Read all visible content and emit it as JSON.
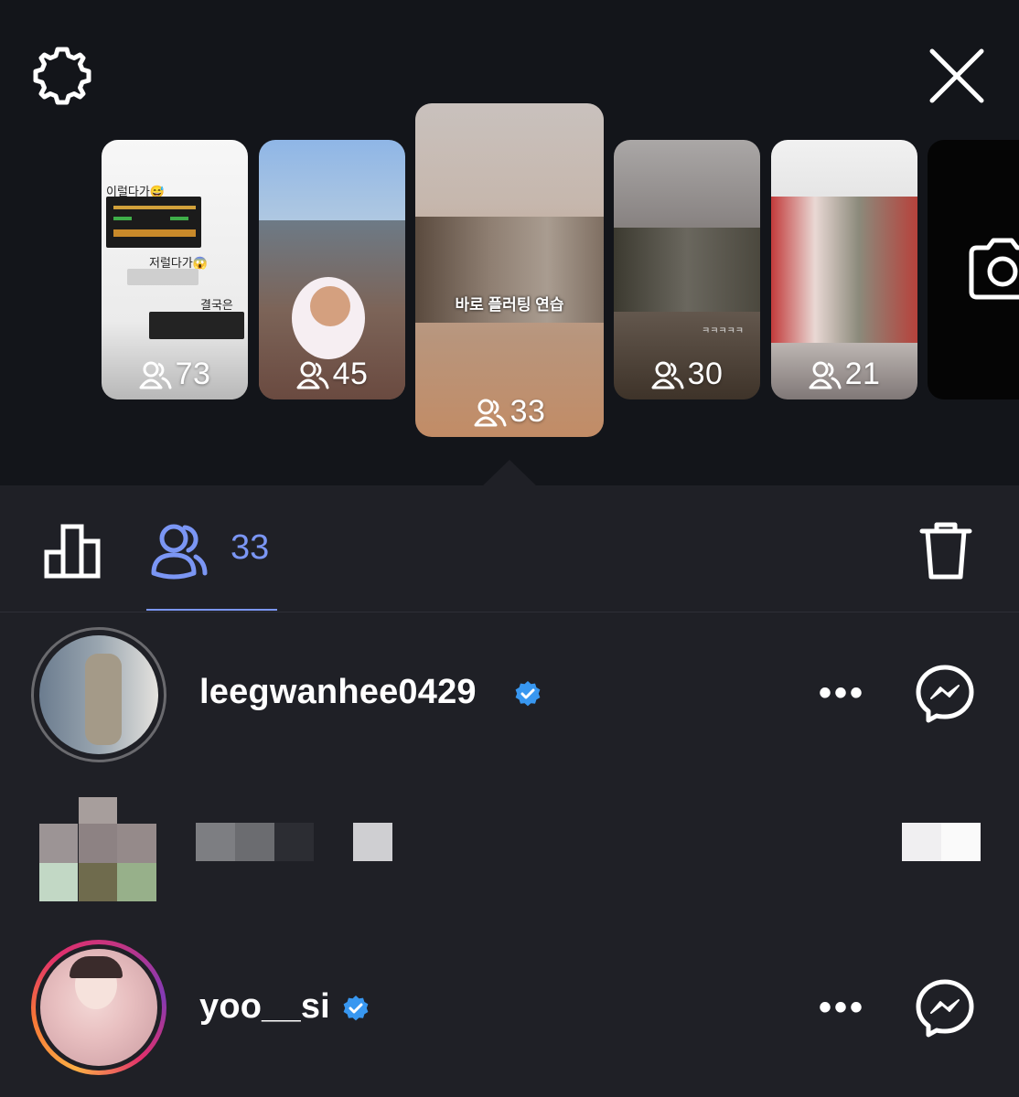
{
  "header": {
    "settings_icon": "gear-icon",
    "close_icon": "close-icon"
  },
  "stories": [
    {
      "viewers": "73",
      "text_1": "이럴다가😅",
      "text_2": "저럴다가😱",
      "text_3": "결국은🙈"
    },
    {
      "viewers": "45"
    },
    {
      "viewers": "33",
      "caption": "바로 플러팅 연습"
    },
    {
      "viewers": "30",
      "caption": "ㅋㅋㅋㅋㅋ"
    },
    {
      "viewers": "21"
    }
  ],
  "camera_icon": "camera-icon",
  "tabs": {
    "insights_icon": "bar-chart-icon",
    "viewers_icon": "viewers-icon",
    "viewer_count": "33",
    "delete_icon": "trash-icon"
  },
  "viewers": [
    {
      "username": "leegwanhee0429",
      "verified": true,
      "more": "•••"
    },
    {
      "username": "",
      "verified": false,
      "more": ""
    },
    {
      "username": "yoo__si",
      "verified": true,
      "more": "•••"
    }
  ],
  "colors": {
    "accent": "#7b96f4",
    "verified": "#3897f0",
    "background_top": "#13151a",
    "background_bottom": "#1f2026"
  }
}
